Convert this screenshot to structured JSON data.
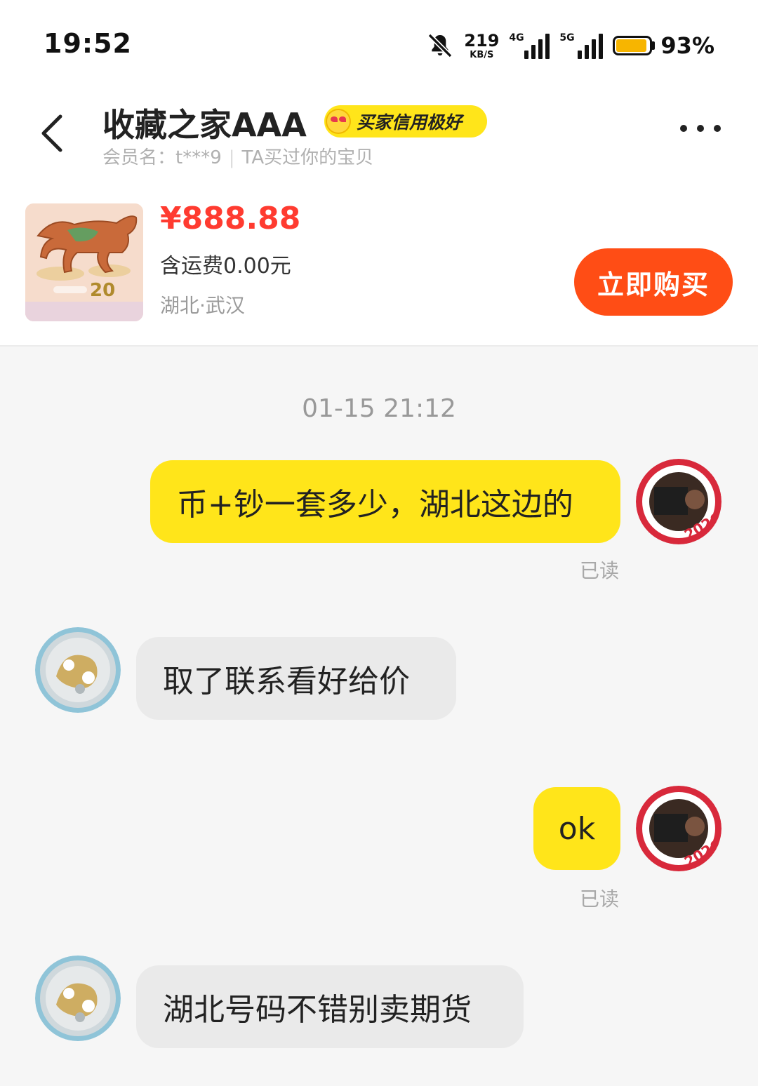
{
  "status_bar": {
    "time": "19:52",
    "net_speed_value": "219",
    "net_speed_unit": "KB/S",
    "signal_1_tag": "4G",
    "signal_2_tag": "5G",
    "battery": "93%",
    "battery_level": 0.93,
    "icons": [
      "bell-off-icon",
      "signal-icon",
      "battery-icon"
    ]
  },
  "header": {
    "title": "收藏之家AAA",
    "badge": "买家信用极好",
    "member_label": "会员名：t***9",
    "bought_note": "TA买过你的宝贝"
  },
  "product": {
    "price": "¥888.88",
    "shipping": "含运费0.00元",
    "location": "湖北·武汉",
    "buy_label": "立即购买"
  },
  "chat": {
    "timestamp": "01-15 21:12",
    "messages": [
      {
        "from": "me",
        "text": "币+钞一套多少，湖北这边的",
        "status": "已读"
      },
      {
        "from": "them",
        "text": "取了联系看好给价"
      },
      {
        "from": "me",
        "text": "ok",
        "status": "已读"
      },
      {
        "from": "them",
        "text": "湖北号码不错别卖期货"
      }
    ]
  },
  "colors": {
    "accent_yellow": "#ffe51a",
    "buy_orange": "#ff4d15",
    "price_red": "#ff3b30"
  }
}
